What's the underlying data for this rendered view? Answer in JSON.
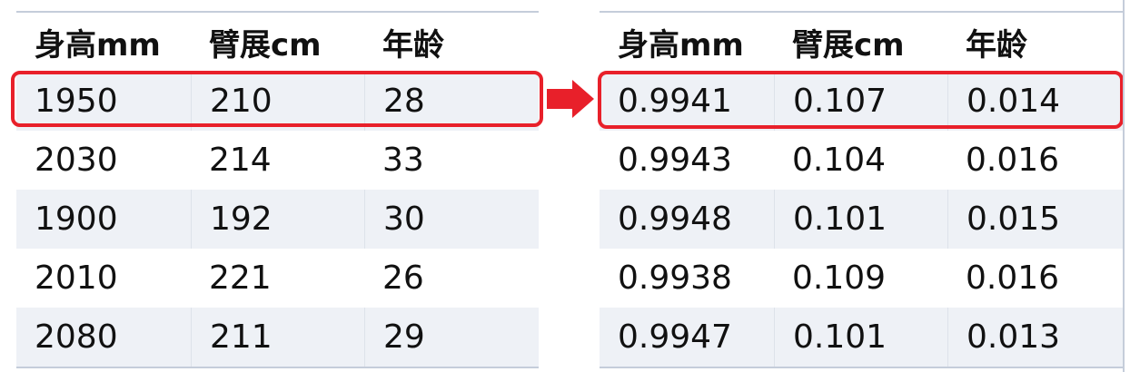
{
  "left_table": {
    "headers": [
      "身高mm",
      "臂展cm",
      "年龄"
    ],
    "rows": [
      [
        "1950",
        "210",
        "28"
      ],
      [
        "2030",
        "214",
        "33"
      ],
      [
        "1900",
        "192",
        "30"
      ],
      [
        "2010",
        "221",
        "26"
      ],
      [
        "2080",
        "211",
        "29"
      ]
    ]
  },
  "right_table": {
    "headers": [
      "身高mm",
      "臂展cm",
      "年龄"
    ],
    "rows": [
      [
        "0.9941",
        "0.107",
        "0.014"
      ],
      [
        "0.9943",
        "0.104",
        "0.016"
      ],
      [
        "0.9948",
        "0.101",
        "0.015"
      ],
      [
        "0.9938",
        "0.109",
        "0.016"
      ],
      [
        "0.9947",
        "0.101",
        "0.013"
      ]
    ]
  },
  "colors": {
    "highlight": "#e8202a",
    "row_shade": "#eef1f6",
    "rule": "#c5cdda"
  },
  "icons": {
    "arrow": "arrow-right-icon"
  }
}
